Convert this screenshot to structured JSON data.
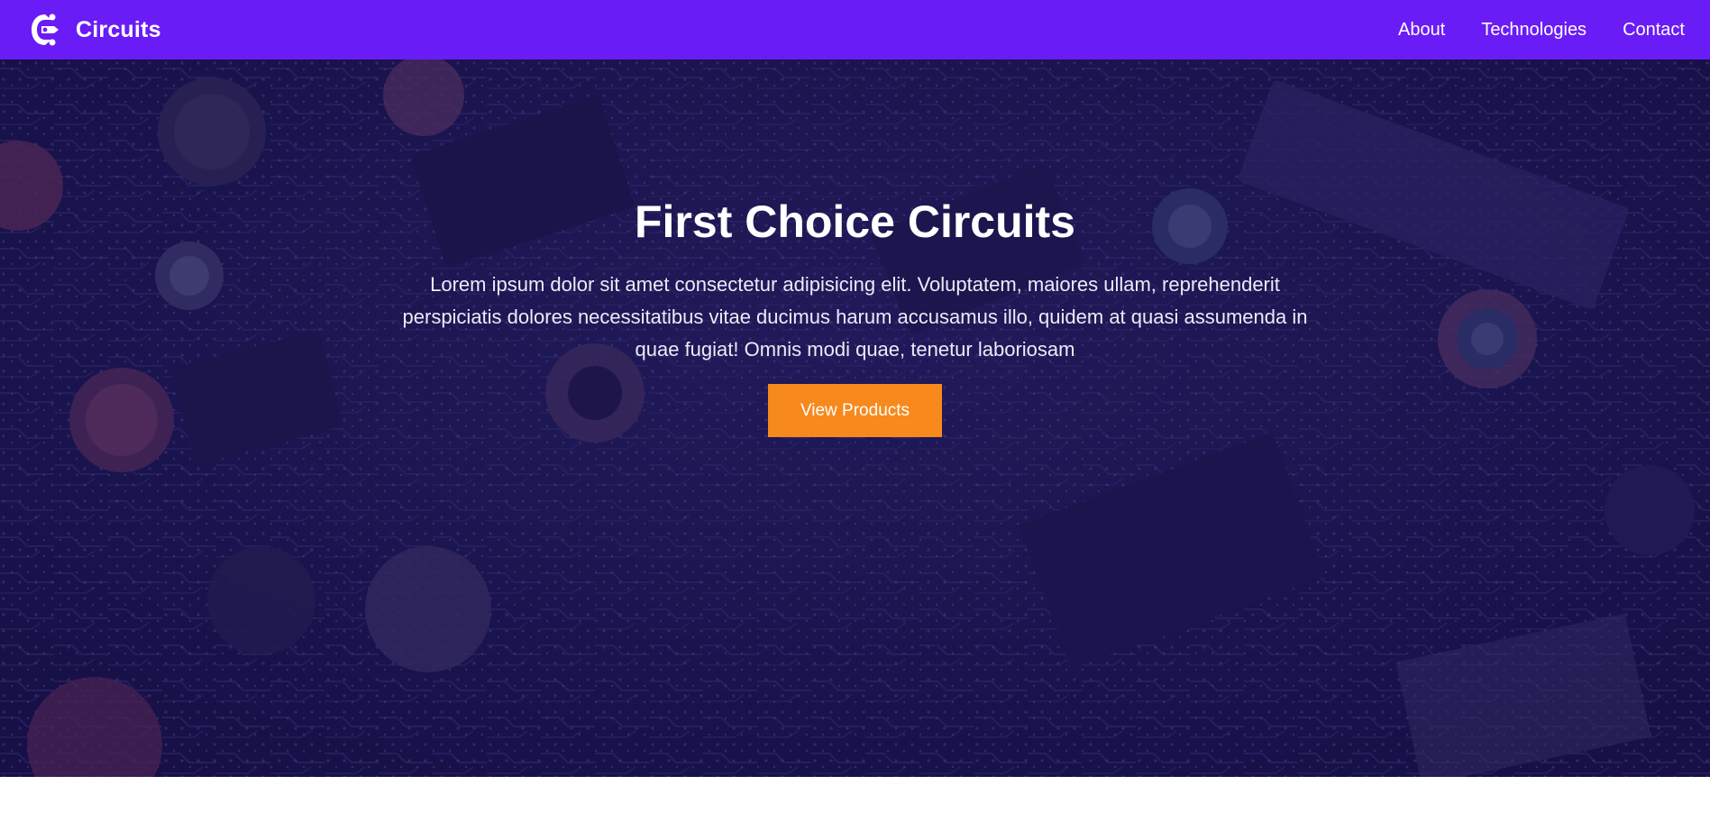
{
  "brand": {
    "name": "Circuits",
    "logo_icon": "circuits-logo-icon"
  },
  "nav": {
    "links": [
      {
        "label": "About"
      },
      {
        "label": "Technologies"
      },
      {
        "label": "Contact"
      }
    ]
  },
  "hero": {
    "title": "First Choice Circuits",
    "text": "Lorem ipsum dolor sit amet consectetur adipisicing elit. Voluptatem, maiores ullam, reprehenderit perspiciatis dolores necessitatibus vitae ducimus harum accusamus illo, quidem at quasi assumenda in quae fugiat! Omnis modi quae, tenetur laboriosam",
    "button_label": "View Products",
    "background": "circuit-board-photo"
  },
  "colors": {
    "navbar": "#6a1cf6",
    "accent_button": "#f7891d",
    "hero_overlay": "#191455",
    "text_light": "#ffffff"
  }
}
